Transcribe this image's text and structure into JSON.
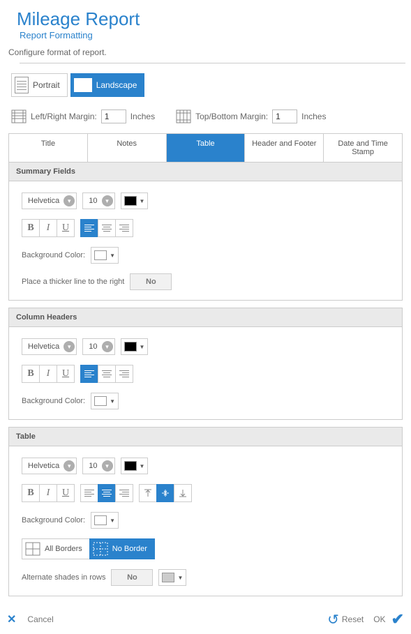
{
  "header": {
    "title": "Mileage Report",
    "subtitle": "Report Formatting",
    "description": "Configure format of report."
  },
  "orientation": {
    "portrait": "Portrait",
    "landscape": "Landscape",
    "active": "landscape"
  },
  "margins": {
    "lr_label": "Left/Right Margin:",
    "lr_value": "1",
    "tb_label": "Top/Bottom Margin:",
    "tb_value": "1",
    "unit": "Inches"
  },
  "tabs": {
    "items": [
      "Title",
      "Notes",
      "Table",
      "Header and Footer",
      "Date and Time Stamp"
    ],
    "active_index": 2
  },
  "sections": {
    "summary": {
      "title": "Summary Fields",
      "font": "Helvetica",
      "size": "10",
      "text_color": "#000000",
      "bg_label": "Background Color:",
      "bg_color": "#ffffff",
      "thicker_label": "Place a thicker line to the right",
      "thicker_value": "No"
    },
    "columns": {
      "title": "Column Headers",
      "font": "Helvetica",
      "size": "10",
      "text_color": "#000000",
      "bg_label": "Background Color:",
      "bg_color": "#ffffff"
    },
    "table": {
      "title": "Table",
      "font": "Helvetica",
      "size": "10",
      "text_color": "#000000",
      "bg_label": "Background Color:",
      "bg_color": "#ffffff",
      "all_borders": "All Borders",
      "no_border": "No Border",
      "alt_label": "Alternate shades in rows",
      "alt_value": "No",
      "alt_color": "#cccccc"
    }
  },
  "footer": {
    "cancel": "Cancel",
    "reset": "Reset",
    "ok": "OK"
  }
}
